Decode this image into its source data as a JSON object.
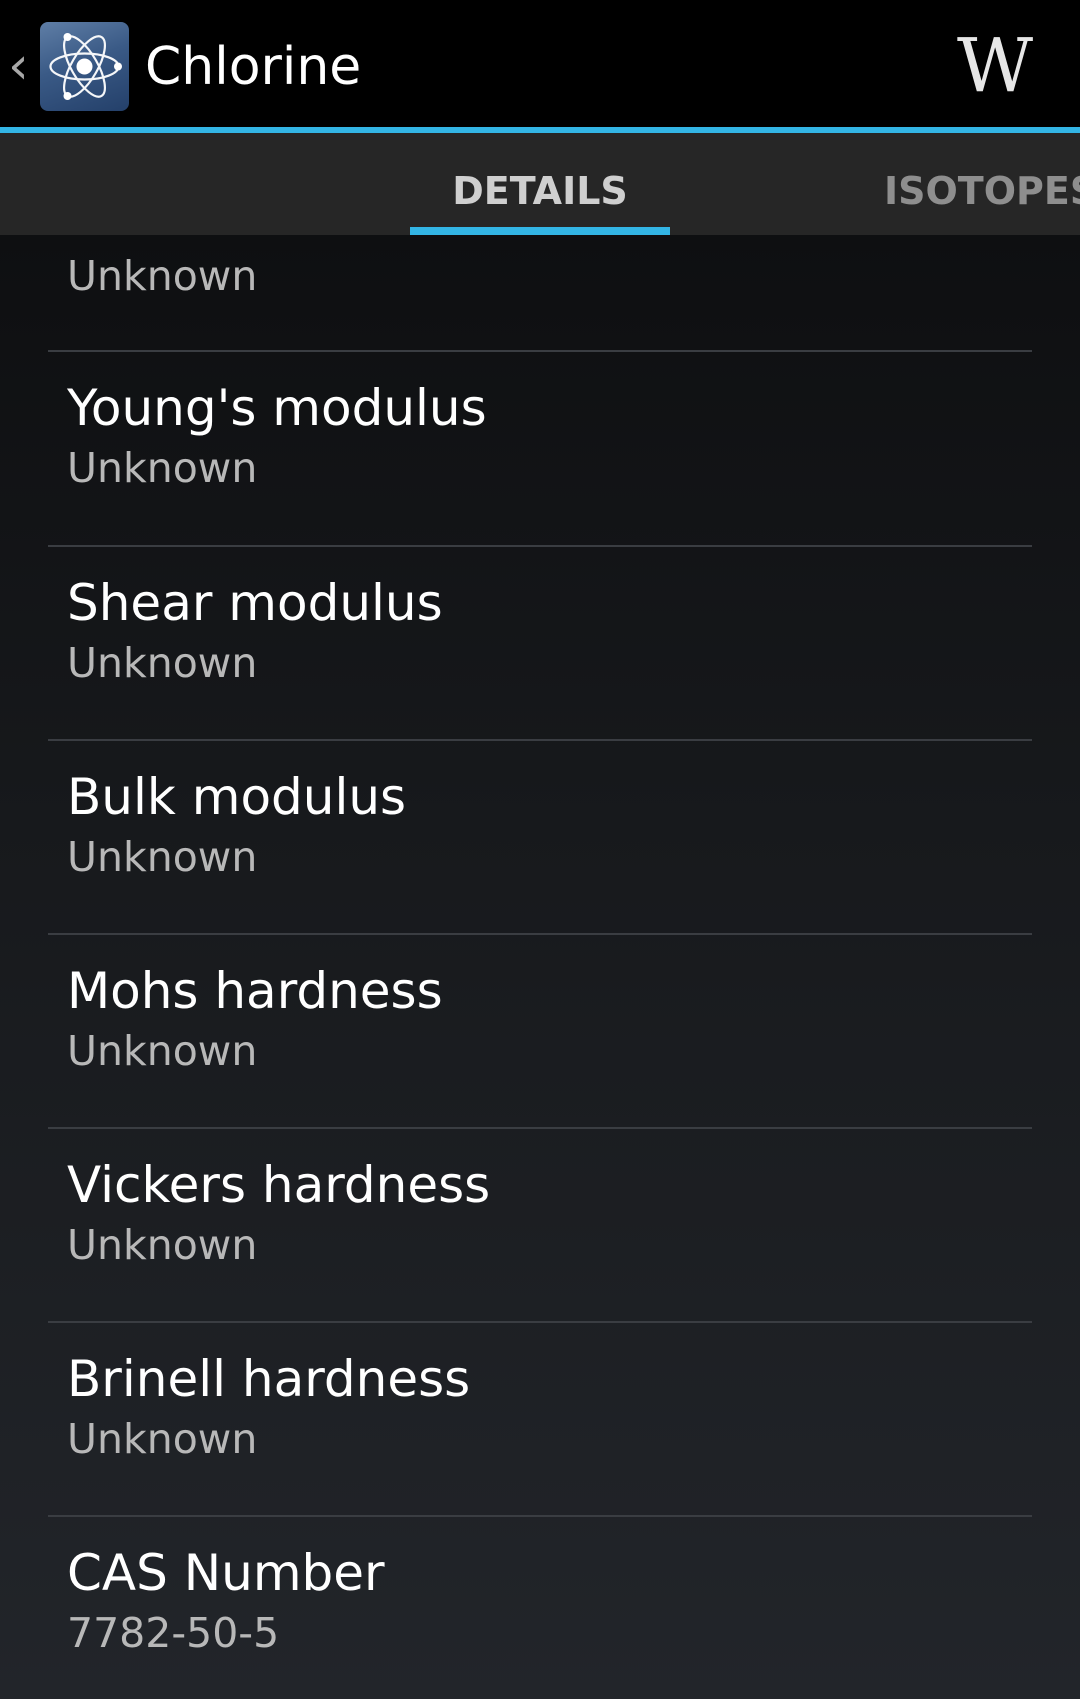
{
  "action_bar": {
    "title": "Chlorine",
    "back_icon": "chevron-left-icon",
    "app_icon": "atom-icon",
    "wiki_label": "W",
    "accent_color": "#33b5e5"
  },
  "tabs": [
    {
      "label": "DETAILS",
      "selected": true
    },
    {
      "label": "ISOTOPES",
      "selected": false
    }
  ],
  "properties": {
    "partial": {
      "value": "Unknown"
    },
    "items": [
      {
        "label": "Young's modulus",
        "value": "Unknown"
      },
      {
        "label": "Shear modulus",
        "value": "Unknown"
      },
      {
        "label": "Bulk modulus",
        "value": "Unknown"
      },
      {
        "label": "Mohs hardness",
        "value": "Unknown"
      },
      {
        "label": "Vickers hardness",
        "value": "Unknown"
      },
      {
        "label": "Brinell hardness",
        "value": "Unknown"
      },
      {
        "label": "CAS Number",
        "value": "7782-50-5"
      }
    ]
  }
}
